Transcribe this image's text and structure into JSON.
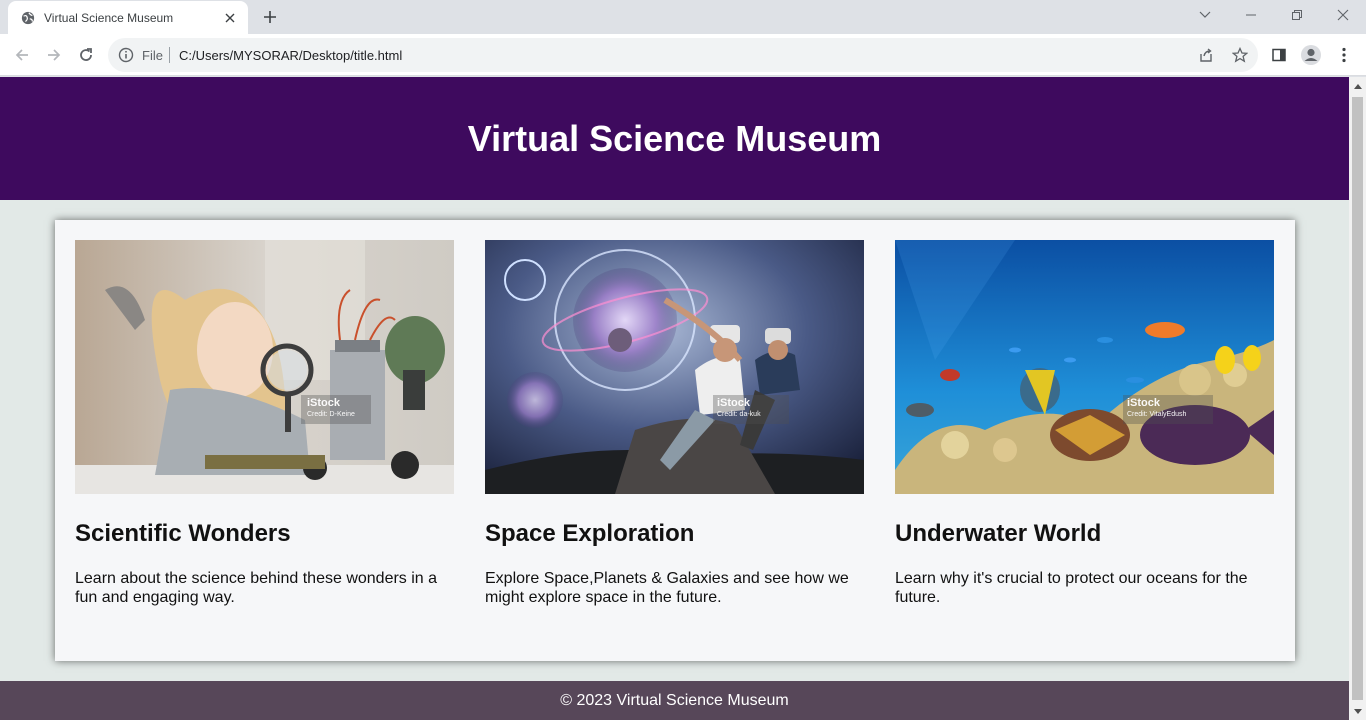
{
  "browser": {
    "tab_title": "Virtual Science Museum",
    "omnibox_scheme": "File",
    "url": "C:/Users/MYSORAR/Desktop/title.html"
  },
  "page": {
    "header_title": "Virtual Science Museum",
    "cards": [
      {
        "title": "Scientific Wonders",
        "description": "Learn about the science behind these wonders in a fun and engaging way.",
        "image_watermark": "iStock",
        "image_credit": "Credit: D-Keine"
      },
      {
        "title": "Space Exploration",
        "description": "Explore Space,Planets & Galaxies and see how we might explore space in the future.",
        "image_watermark": "iStock",
        "image_credit": "Credit: da-kuk"
      },
      {
        "title": "Underwater World",
        "description": "Learn why it's crucial to protect our oceans for the future.",
        "image_watermark": "iStock",
        "image_credit": "Credit: VitalyEdush"
      }
    ],
    "footer_text": "© 2023 Virtual Science Museum"
  },
  "colors": {
    "header_bg": "#3e0a5e",
    "footer_bg": "#574759",
    "page_bg": "#e2e9e7",
    "panel_bg": "#f6f7f9"
  }
}
